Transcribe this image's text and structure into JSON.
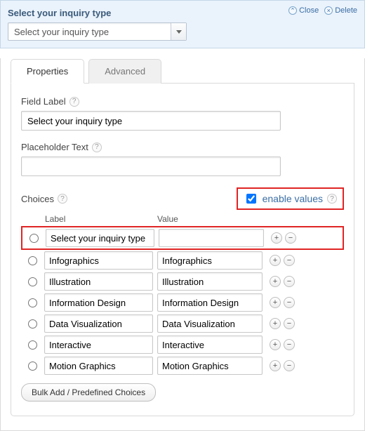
{
  "panel": {
    "title": "Select your inquiry type",
    "close_label": "Close",
    "delete_label": "Delete",
    "dropdown_value": "Select your inquiry type"
  },
  "tabs": {
    "properties": "Properties",
    "advanced": "Advanced"
  },
  "form": {
    "field_label_title": "Field Label",
    "field_label_value": "Select your inquiry type",
    "placeholder_title": "Placeholder Text",
    "placeholder_value": "",
    "choices_title": "Choices",
    "enable_values_label": "enable values",
    "col_label": "Label",
    "col_value": "Value",
    "bulk_label": "Bulk Add / Predefined Choices"
  },
  "choices": [
    {
      "label": "Select your inquiry type",
      "value": ""
    },
    {
      "label": "Infographics",
      "value": "Infographics"
    },
    {
      "label": "Illustration",
      "value": "Illustration"
    },
    {
      "label": "Information Design",
      "value": "Information Design"
    },
    {
      "label": "Data Visualization",
      "value": "Data Visualization"
    },
    {
      "label": "Interactive",
      "value": "Interactive"
    },
    {
      "label": "Motion Graphics",
      "value": "Motion Graphics"
    }
  ]
}
